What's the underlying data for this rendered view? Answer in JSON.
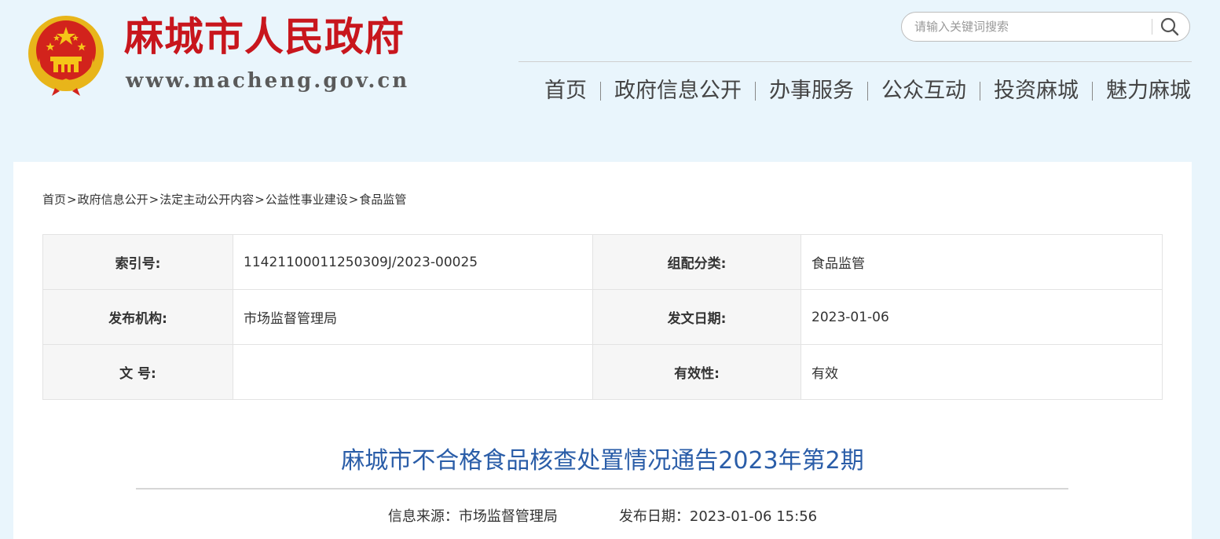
{
  "header": {
    "site_title": "麻城市人民政府",
    "site_url": "www.macheng.gov.cn",
    "emblem_icon": "national-emblem-icon",
    "brand_color": "#c8161d"
  },
  "search": {
    "placeholder": "请输入关键词搜索",
    "value": "",
    "icon": "search-icon"
  },
  "nav": {
    "items": [
      {
        "label": "首页"
      },
      {
        "label": "政府信息公开"
      },
      {
        "label": "办事服务"
      },
      {
        "label": "公众互动"
      },
      {
        "label": "投资麻城"
      },
      {
        "label": "魅力麻城"
      }
    ]
  },
  "breadcrumb": {
    "items": [
      "首页",
      "政府信息公开",
      "法定主动公开内容",
      "公益性事业建设",
      "食品监管"
    ],
    "separator": ">"
  },
  "meta": {
    "rows": [
      {
        "label1": "索引号:",
        "value1": "11421100011250309J/2023-00025",
        "label2": "组配分类:",
        "value2": "食品监管"
      },
      {
        "label1": "发布机构:",
        "value1": "市场监督管理局",
        "label2": "发文日期:",
        "value2": "2023-01-06"
      },
      {
        "label1": "文 号:",
        "value1": "",
        "label2": "有效性:",
        "value2": "有效"
      }
    ]
  },
  "article": {
    "title": "麻城市不合格食品核查处置情况通告2023年第2期",
    "source_label": "信息来源：",
    "source": "市场监督管理局",
    "date_label": "发布日期：",
    "date": "2023-01-06 15:56",
    "title_color": "#2a5da8"
  }
}
